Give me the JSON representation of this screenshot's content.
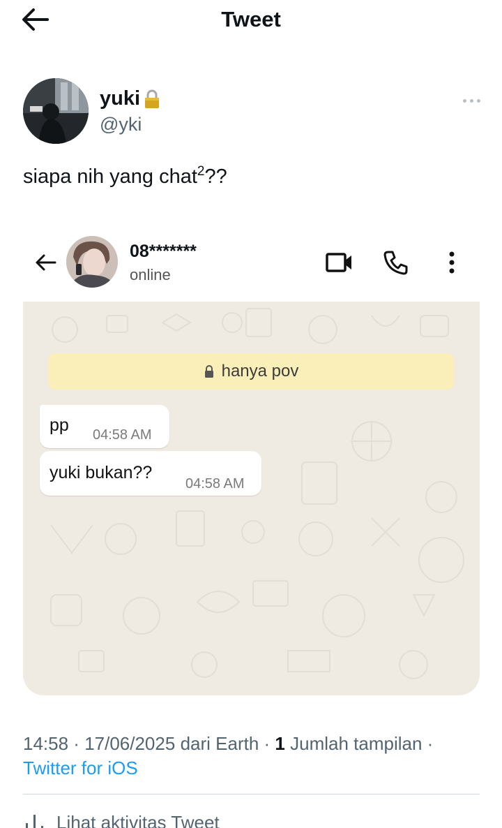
{
  "header": {
    "title": "Tweet",
    "back_icon": "arrow-left-icon"
  },
  "author": {
    "name": "yuki",
    "handle": "@yki",
    "lock_icon": "padlock-icon"
  },
  "tweet": {
    "text": "siapa nih yang chat",
    "superscript": "2",
    "suffix": "??"
  },
  "embedded_chat": {
    "contact_name": "08*******",
    "status": "online",
    "system_message": "hanya pov",
    "messages": [
      {
        "text": "pp",
        "time": "04:58 AM"
      },
      {
        "text": "yuki bukan??",
        "time": "04:58 AM"
      }
    ]
  },
  "footer": {
    "time": "14:58",
    "date": "17/06/2025",
    "location": "dari Earth",
    "views_count": "1",
    "views_label": "Jumlah tampilan",
    "source": "Twitter for iOS",
    "activity_label": "Lihat aktivitas Tweet"
  },
  "colors": {
    "link": "#1d9bf0",
    "secondary_text": "#536471",
    "chat_bg": "#efeae2",
    "system_bubble": "#fbefb9"
  }
}
